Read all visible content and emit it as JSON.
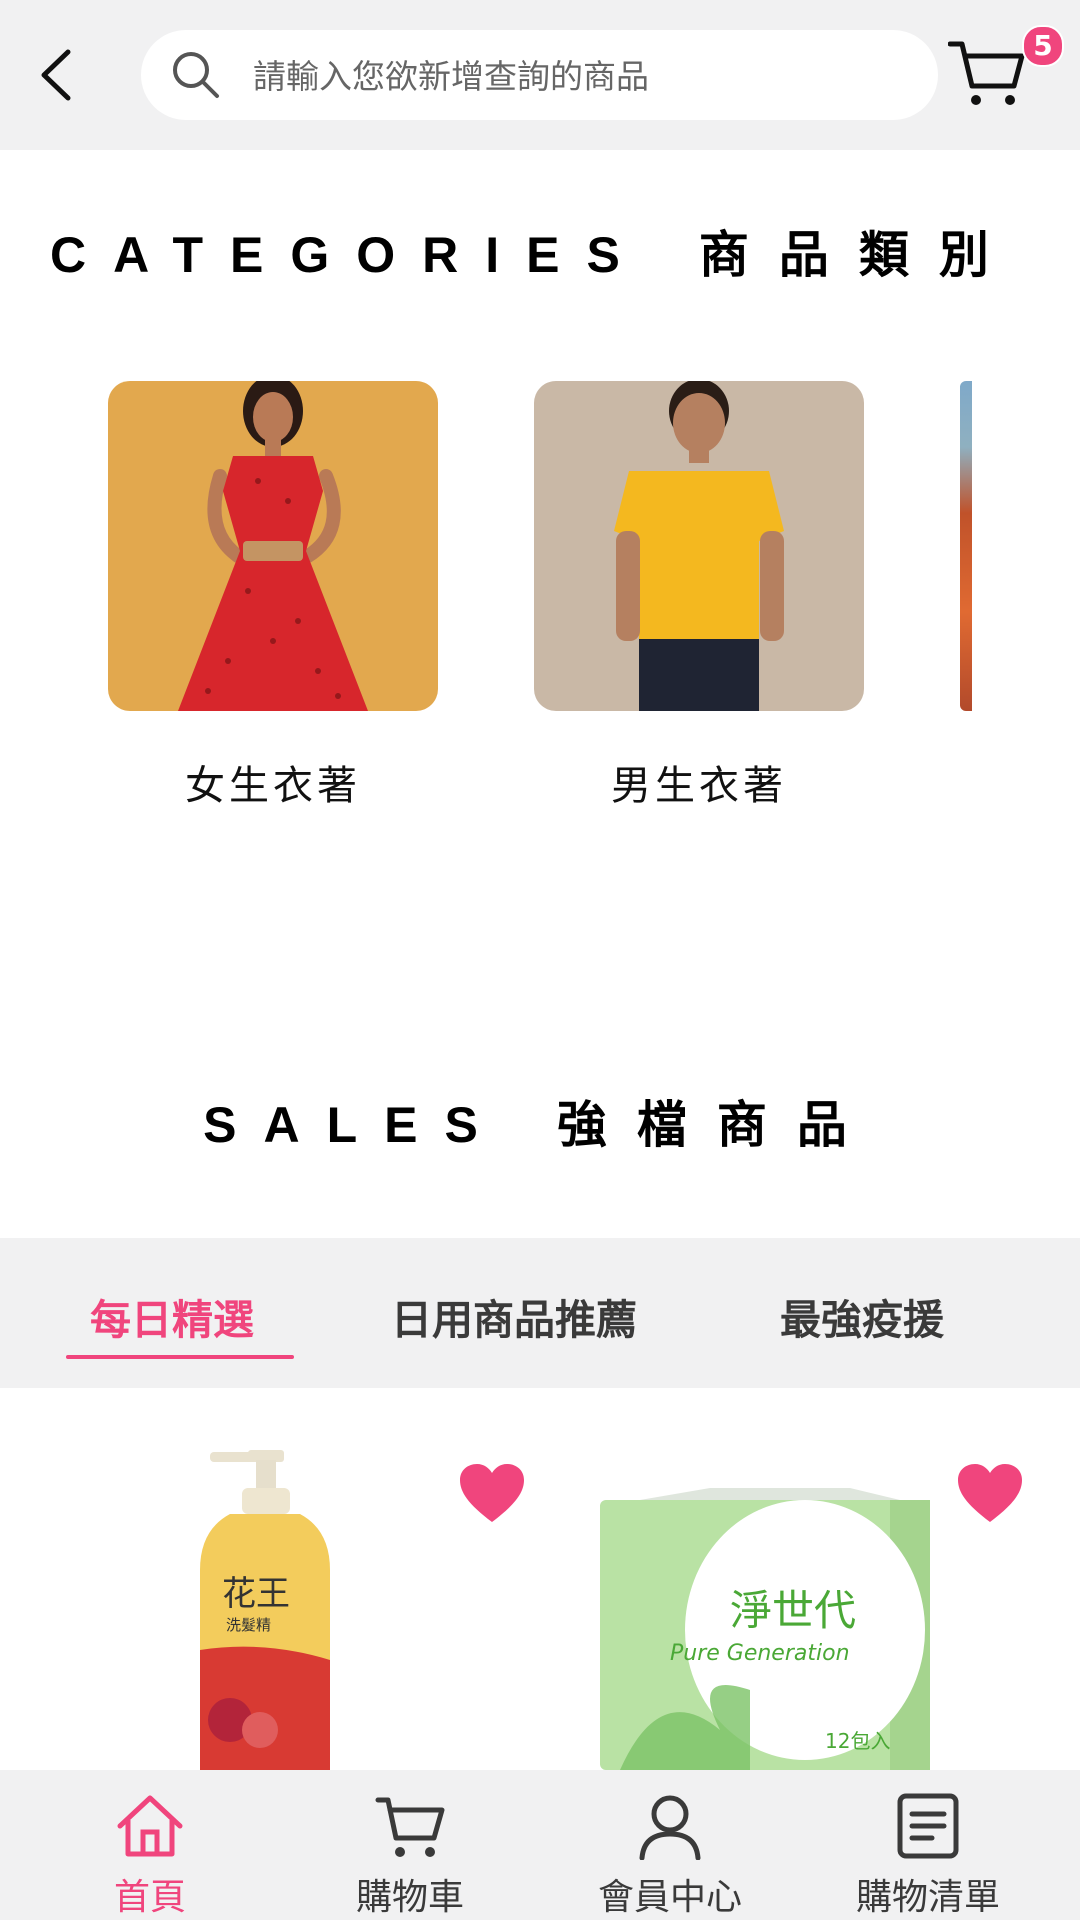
{
  "header": {
    "search_placeholder": "請輸入您欲新增查詢的商品",
    "cart_count": "5"
  },
  "categories": {
    "title_en": "CATEGORIES",
    "title_zh": "商品類別",
    "items": [
      {
        "label": "女生衣著"
      },
      {
        "label": "男生衣著"
      }
    ]
  },
  "sales": {
    "title_en": "SALES",
    "title_zh": "強檔商品",
    "tabs": [
      {
        "label": "每日精選",
        "active": true
      },
      {
        "label": "日用商品推薦",
        "active": false
      },
      {
        "label": "最強疫援",
        "active": false
      }
    ],
    "products": [
      {
        "brand_text": "花王",
        "sub_text": "洗髮精",
        "favorite": true
      },
      {
        "brand_text": "淨世代",
        "sub_text": "Pure Generation",
        "pack_text": "12包入",
        "favorite": true
      }
    ]
  },
  "bottom_nav": {
    "items": [
      {
        "label": "首頁",
        "icon": "home-icon",
        "active": true
      },
      {
        "label": "購物車",
        "icon": "cart-icon",
        "active": false
      },
      {
        "label": "會員中心",
        "icon": "user-icon",
        "active": false
      },
      {
        "label": "購物清單",
        "icon": "list-icon",
        "active": false
      }
    ]
  },
  "colors": {
    "accent": "#f0457d",
    "bar_background": "#f1f1f2"
  }
}
